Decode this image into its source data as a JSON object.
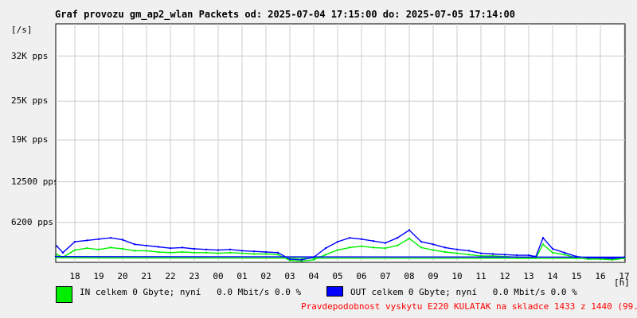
{
  "colors": {
    "in": "#00ee00",
    "out": "#0000ff",
    "grid": "#cccccc",
    "footer": "#ff0000"
  },
  "legend": {
    "in_text": "IN celkem 0 Gbyte; nyní   0.0 Mbit/s 0.0 %",
    "out_text": "OUT celkem 0 Gbyte; nyní   0.0 Mbit/s 0.0 %"
  },
  "footer_text": "Pravdepodobnost vyskytu E220 KULATAK na skladce 1433 z 1440 (99.5 %)",
  "chart_data": {
    "type": "area",
    "title": "Graf provozu gm_ap2_wlan Packets od: 2025-07-04 17:15:00 do: 2025-07-05 17:14:00",
    "y_unit_label": "[/s]",
    "x_unit_label": "[h]",
    "ylim": [
      0,
      37000
    ],
    "y_ticks": [
      {
        "value": 6200,
        "label": "6200 pps"
      },
      {
        "value": 12500,
        "label": "12500 pps"
      },
      {
        "value": 19000,
        "label": "19K pps"
      },
      {
        "value": 25000,
        "label": "25K pps"
      },
      {
        "value": 32000,
        "label": "32K pps"
      }
    ],
    "x_ticks": [
      "18",
      "19",
      "20",
      "21",
      "22",
      "23",
      "00",
      "01",
      "02",
      "03",
      "04",
      "05",
      "06",
      "07",
      "08",
      "09",
      "10",
      "11",
      "12",
      "13",
      "14",
      "15",
      "16",
      "17"
    ],
    "series": [
      {
        "name": "IN",
        "x": [
          17.25,
          17.5,
          18,
          18.5,
          19,
          19.5,
          20,
          20.5,
          21,
          21.5,
          22,
          22.5,
          23,
          23.5,
          0,
          0.5,
          1,
          1.5,
          2,
          2.5,
          3,
          3.5,
          4,
          4.5,
          5,
          5.5,
          6,
          6.5,
          7,
          7.5,
          8,
          8.5,
          9,
          9.5,
          10,
          10.5,
          11,
          11.5,
          12,
          12.5,
          13,
          13.3,
          13.6,
          14,
          14.5,
          15,
          15.5,
          16,
          16.5,
          17,
          17.2
        ],
        "values": [
          1200,
          800,
          1900,
          2200,
          2000,
          2300,
          2100,
          1800,
          1800,
          1600,
          1500,
          1600,
          1500,
          1500,
          1400,
          1500,
          1400,
          1300,
          1300,
          1200,
          300,
          200,
          400,
          1200,
          1900,
          2300,
          2500,
          2300,
          2200,
          2600,
          3700,
          2300,
          1900,
          1600,
          1400,
          1200,
          1000,
          1000,
          900,
          800,
          800,
          700,
          2800,
          1500,
          1200,
          700,
          500,
          500,
          400,
          600,
          700
        ]
      },
      {
        "name": "OUT",
        "x": [
          17.25,
          17.5,
          18,
          18.5,
          19,
          19.5,
          20,
          20.5,
          21,
          21.5,
          22,
          22.5,
          23,
          23.5,
          0,
          0.5,
          1,
          1.5,
          2,
          2.5,
          3,
          3.5,
          4,
          4.5,
          5,
          5.5,
          6,
          6.5,
          7,
          7.5,
          8,
          8.5,
          9,
          9.5,
          10,
          10.5,
          11,
          11.5,
          12,
          12.5,
          13,
          13.3,
          13.6,
          14,
          14.5,
          15,
          15.5,
          16,
          16.5,
          17,
          17.2
        ],
        "values": [
          2500,
          1500,
          3200,
          3400,
          3600,
          3800,
          3500,
          2800,
          2600,
          2400,
          2200,
          2300,
          2100,
          2000,
          1900,
          2000,
          1800,
          1700,
          1600,
          1500,
          500,
          400,
          800,
          2200,
          3200,
          3800,
          3600,
          3300,
          3000,
          3800,
          5000,
          3200,
          2800,
          2300,
          2000,
          1800,
          1400,
          1300,
          1200,
          1100,
          1100,
          900,
          3800,
          2100,
          1500,
          900,
          700,
          700,
          600,
          800,
          900
        ]
      }
    ],
    "grid": true
  }
}
